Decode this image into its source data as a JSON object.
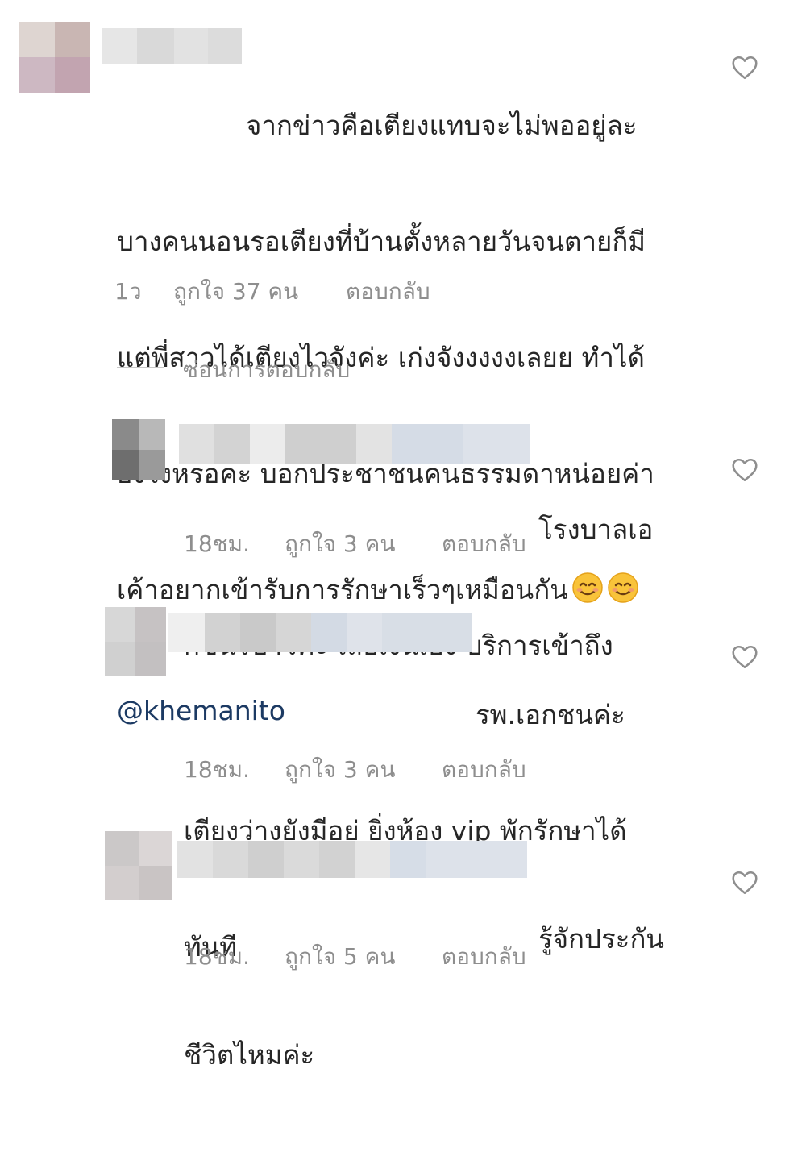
{
  "comments": [
    {
      "text_lines": [
        "จากข่าวคือเตียงแทบจะไม่พออยู่ละ",
        "บางคนนอนรอเตียงที่บ้านตั้งหลายวันจนตายก็มี",
        "แต่พี่สาวได้เตียงไวจังค่ะ เก่งจังงงงงเลยย ทำได้",
        "ยังไงหรอคะ บอกประชาชนคนธรรมดาหน่อยค่า",
        "เค้าอยากเข้ารับการรักษาเร็วๆเหมือนกัน"
      ],
      "emoji_icons": [
        "smiling-face-icon",
        "smiling-face-icon"
      ],
      "mention": "@khemanito",
      "time": "1ว",
      "likes": "ถูกใจ 37 คน",
      "reply": "ตอบกลับ"
    },
    {
      "text_lines": [
        "โรงบาลเอ",
        "กชนรึป่าวค่ะ เสียเงินเอง บริการเข้าถึง"
      ],
      "time": "18ชม.",
      "likes": "ถูกใจ 3 คน",
      "reply": "ตอบกลับ"
    },
    {
      "text_lines": [
        "รพ.เอกชนค่ะ",
        "เตียงว่างยังมีอยู่ ยิ่งห้อง vip พักรักษาได้",
        "ทันที"
      ],
      "time": "18ชม.",
      "likes": "ถูกใจ 3 คน",
      "reply": "ตอบกลับ"
    },
    {
      "text_lines": [
        "รู้จักประกัน",
        "ชีวิตไหมค่ะ"
      ],
      "time": "18ชม.",
      "likes": "ถูกใจ 5 คน",
      "reply": "ตอบกลับ"
    }
  ],
  "hide_replies": "ซ่อนการตอบกลับ",
  "icons": {
    "like": "heart-outline-icon",
    "emoji": "smiling-face-icon"
  },
  "colors": {
    "text": "#262626",
    "meta": "#8e8e8e",
    "mention": "#1c3a63",
    "blur_gray": "#d6d6d6",
    "blur_blue": "#d3dae4"
  }
}
